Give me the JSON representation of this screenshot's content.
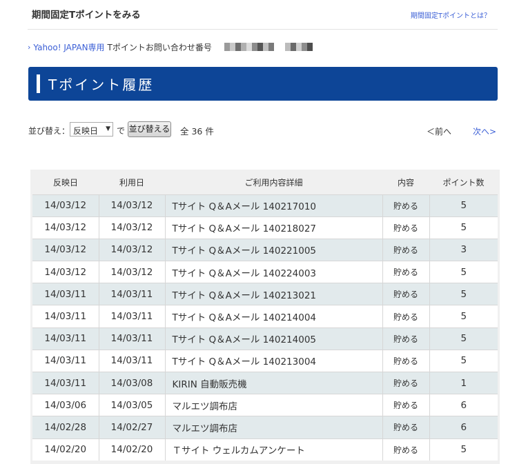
{
  "header": {
    "title": "期間固定Tポイントをみる",
    "link": "期間固定Tポイントとは？"
  },
  "inquiry": {
    "yahoo_label": "Yahoo! JAPAN専用",
    "label": "Tポイントお問い合わせ番号"
  },
  "banner": {
    "title": "Tポイント履歴"
  },
  "controls": {
    "sort_label": "並び替え：",
    "sort_selected": "反映日",
    "de": "で",
    "sort_button": "並び替える",
    "total": "全 36 件",
    "prev": "＜前へ",
    "next": "次へ>"
  },
  "table": {
    "headers": [
      "反映日",
      "利用日",
      "ご利用内容詳細",
      "内容",
      "ポイント数"
    ],
    "rows": [
      [
        "14/03/12",
        "14/03/12",
        "Tサイト Q＆Aメール 140217010",
        "貯める",
        "5"
      ],
      [
        "14/03/12",
        "14/03/12",
        "Tサイト Q＆Aメール 140218027",
        "貯める",
        "5"
      ],
      [
        "14/03/12",
        "14/03/12",
        "Tサイト Q＆Aメール 140221005",
        "貯める",
        "3"
      ],
      [
        "14/03/12",
        "14/03/12",
        "Tサイト Q＆Aメール 140224003",
        "貯める",
        "5"
      ],
      [
        "14/03/11",
        "14/03/11",
        "Tサイト Q＆Aメール 140213021",
        "貯める",
        "5"
      ],
      [
        "14/03/11",
        "14/03/11",
        "Tサイト Q＆Aメール 140214004",
        "貯める",
        "5"
      ],
      [
        "14/03/11",
        "14/03/11",
        "Tサイト Q＆Aメール 140214005",
        "貯める",
        "5"
      ],
      [
        "14/03/11",
        "14/03/11",
        "Tサイト Q＆Aメール 140213004",
        "貯める",
        "5"
      ],
      [
        "14/03/11",
        "14/03/08",
        "KIRIN 自動販売機",
        "貯める",
        "1"
      ],
      [
        "14/03/06",
        "14/03/05",
        "マルエツ調布店",
        "貯める",
        "6"
      ],
      [
        "14/02/28",
        "14/02/27",
        "マルエツ調布店",
        "貯める",
        "6"
      ],
      [
        "14/02/20",
        "14/02/20",
        "Ｔサイト ウェルカムアンケート",
        "貯める",
        "5"
      ]
    ]
  },
  "colors": {
    "banner": "#0d4597",
    "link": "#3b5fd6",
    "row_alt": "#e2eaec"
  }
}
